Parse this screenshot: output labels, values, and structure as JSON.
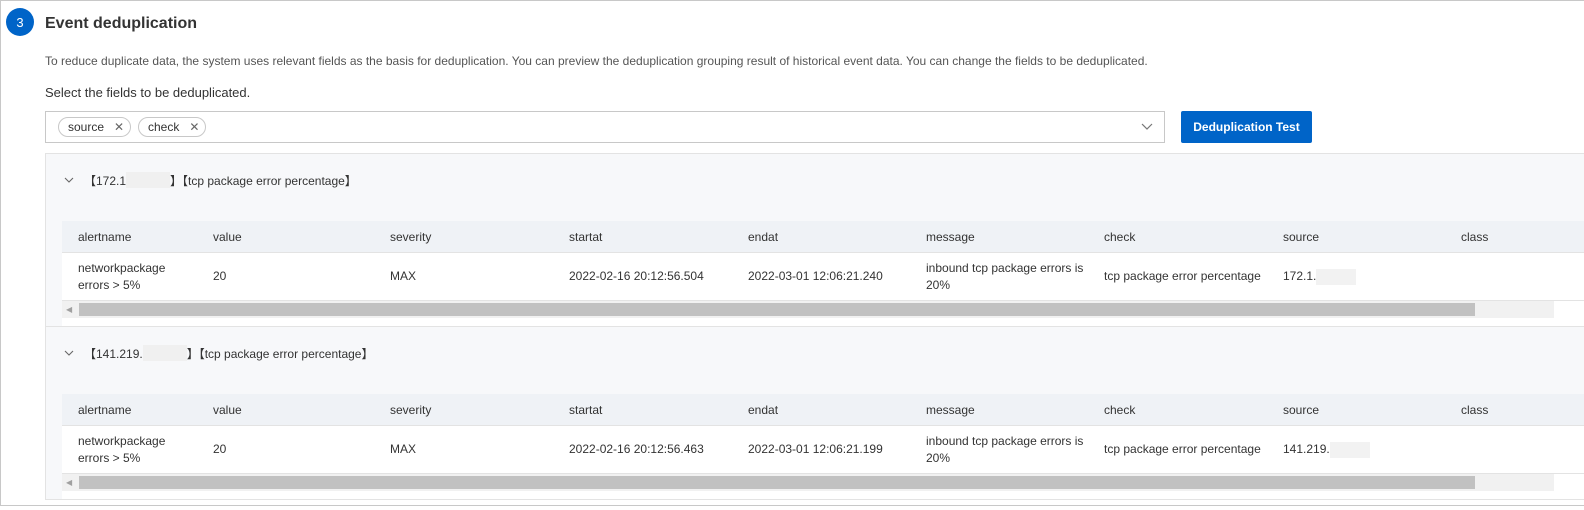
{
  "step_number": "3",
  "title": "Event deduplication",
  "description": "To reduce duplicate data, the system uses relevant fields as the basis for deduplication. You can preview the deduplication grouping result of historical event data. You can change the fields to be deduplicated.",
  "select_label": "Select the fields to be deduplicated.",
  "selected_fields": [
    "source",
    "check"
  ],
  "button_label": "Deduplication Test",
  "accent_color": "#0064c8",
  "columns": [
    "alertname",
    "value",
    "severity",
    "startat",
    "endat",
    "message",
    "check",
    "source",
    "class"
  ],
  "groups": [
    {
      "source_prefix": "【172.1",
      "check_label": "】【tcp package error percentage】",
      "row": {
        "alertname": "networkpackage errors > 5%",
        "value": "20",
        "severity": "MAX",
        "startat": "2022-02-16 20:12:56.504",
        "endat": "2022-03-01 12:06:21.240",
        "message": "inbound tcp package errors is 20%",
        "check": "tcp package error percentage",
        "source": "172.1.",
        "class": ""
      }
    },
    {
      "source_prefix": "【141.219.",
      "check_label": "】【tcp package error percentage】",
      "row": {
        "alertname": "networkpackage errors > 5%",
        "value": "20",
        "severity": "MAX",
        "startat": "2022-02-16 20:12:56.463",
        "endat": "2022-03-01 12:06:21.199",
        "message": "inbound tcp package errors is 20%",
        "check": "tcp package error percentage",
        "source": "141.219.",
        "class": ""
      }
    }
  ]
}
